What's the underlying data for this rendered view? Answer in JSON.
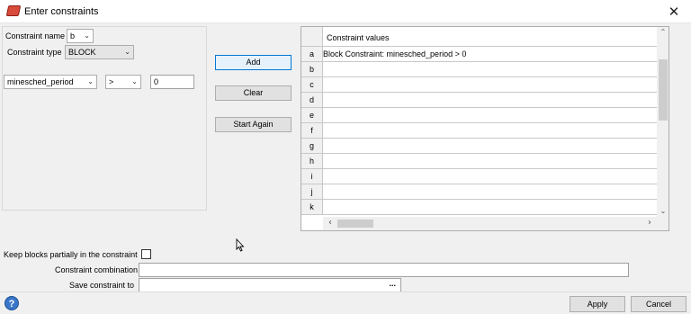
{
  "window": {
    "title": "Enter constraints",
    "close_glyph": "✕",
    "icon": "app-icon"
  },
  "form": {
    "constraint_name_label": "Constraint name",
    "constraint_name_value": "b",
    "constraint_type_label": "Constraint type",
    "constraint_type_value": "BLOCK",
    "field_value": "minesched_period",
    "operator_value": ">",
    "operand_value": "0",
    "dropdown_glyph": "⌄"
  },
  "buttons": {
    "add": "Add",
    "clear": "Clear",
    "start_again": "Start Again",
    "apply": "Apply",
    "cancel": "Cancel"
  },
  "table": {
    "header": "Constraint values",
    "rows": [
      {
        "label": "a",
        "value": "Block Constraint: minesched_period > 0"
      },
      {
        "label": "b",
        "value": ""
      },
      {
        "label": "c",
        "value": ""
      },
      {
        "label": "d",
        "value": ""
      },
      {
        "label": "e",
        "value": ""
      },
      {
        "label": "f",
        "value": ""
      },
      {
        "label": "g",
        "value": ""
      },
      {
        "label": "h",
        "value": ""
      },
      {
        "label": "i",
        "value": ""
      },
      {
        "label": "j",
        "value": ""
      },
      {
        "label": "k",
        "value": ""
      }
    ],
    "scroll_up": "⌃",
    "scroll_down": "⌄",
    "scroll_left": "‹",
    "scroll_right": "›"
  },
  "options": {
    "keep_blocks_label": "Keep blocks partially in the constraint",
    "keep_blocks_checked": false,
    "combination_label": "Constraint combination",
    "combination_value": "",
    "save_label": "Save constraint to",
    "save_value": "",
    "browse_label": "..."
  },
  "footer": {
    "help_glyph": "?"
  }
}
